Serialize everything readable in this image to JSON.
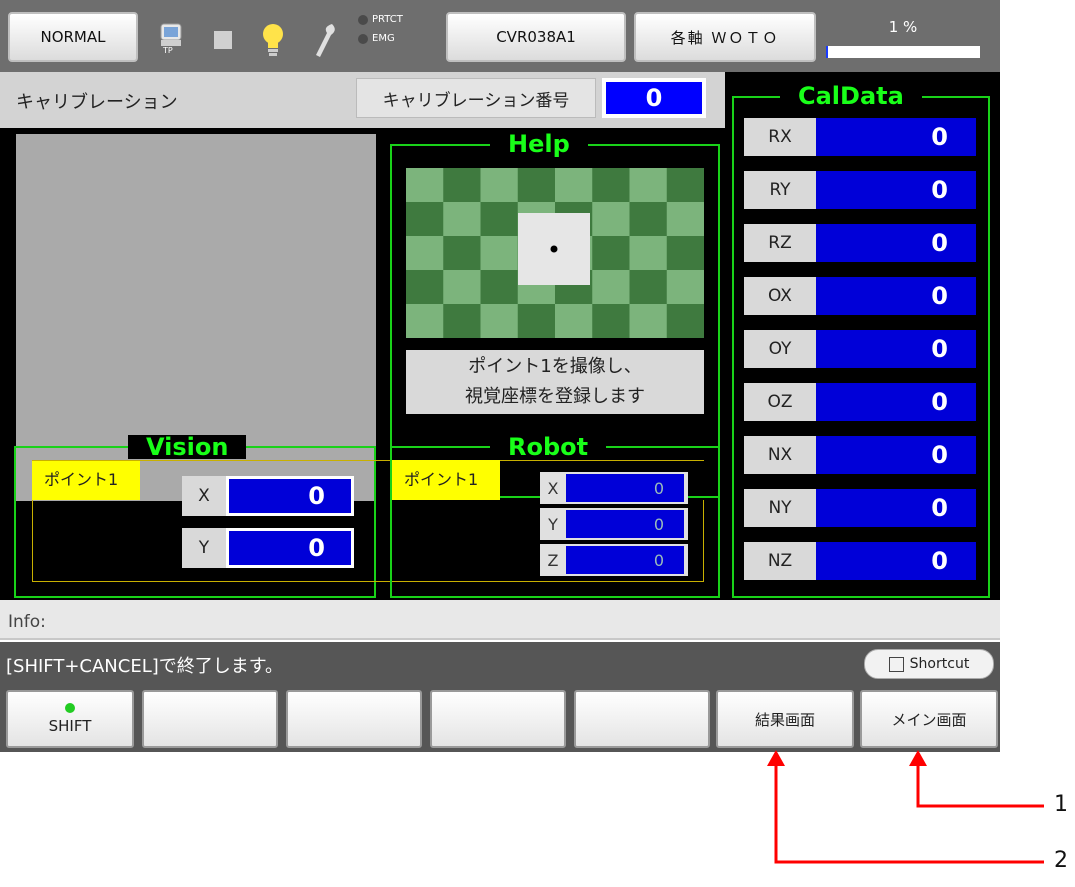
{
  "topbar": {
    "mode": "NORMAL",
    "tp_label": "TP",
    "indicators": [
      "PRTCT",
      "EMG"
    ],
    "robot_name": "CVR038A1",
    "axis_mode": "各軸 ＷＯＴＯ",
    "speed": "1 %",
    "speed_value": 1
  },
  "calib": {
    "title": "キャリブレーション",
    "number_label": "キャリブレーション番号",
    "number_value": "0"
  },
  "help": {
    "title": "Help",
    "message_line1": "ポイント1を撮像し、",
    "message_line2": "視覚座標を登録します"
  },
  "vision": {
    "title": "Vision",
    "point_label": "ポイント1",
    "x_label": "X",
    "x_value": "0",
    "y_label": "Y",
    "y_value": "0"
  },
  "robot": {
    "title": "Robot",
    "point_label": "ポイント1",
    "x_label": "X",
    "x_value": "0",
    "y_label": "Y",
    "y_value": "0",
    "z_label": "Z",
    "z_value": "0"
  },
  "caldata": {
    "title": "CalData",
    "rows": [
      {
        "label": "RX",
        "value": "0"
      },
      {
        "label": "RY",
        "value": "0"
      },
      {
        "label": "RZ",
        "value": "0"
      },
      {
        "label": "OX",
        "value": "0"
      },
      {
        "label": "OY",
        "value": "0"
      },
      {
        "label": "OZ",
        "value": "0"
      },
      {
        "label": "NX",
        "value": "0"
      },
      {
        "label": "NY",
        "value": "0"
      },
      {
        "label": "NZ",
        "value": "0"
      }
    ]
  },
  "info": {
    "label": "Info:",
    "message": "[SHIFT+CANCEL]で終了します。",
    "shortcut": "Shortcut"
  },
  "function_keys": {
    "f1": "SHIFT",
    "f2": "",
    "f3": "",
    "f4": "",
    "f5": "",
    "f6": "結果画面",
    "f7": "メイン画面"
  },
  "callouts": {
    "c1": "1",
    "c2": "2"
  },
  "colors": {
    "frame": "#19d219",
    "title": "#19ff19",
    "value_bg": "#0000d8",
    "point_label": "#ffff00",
    "arrow": "#ff0000"
  }
}
